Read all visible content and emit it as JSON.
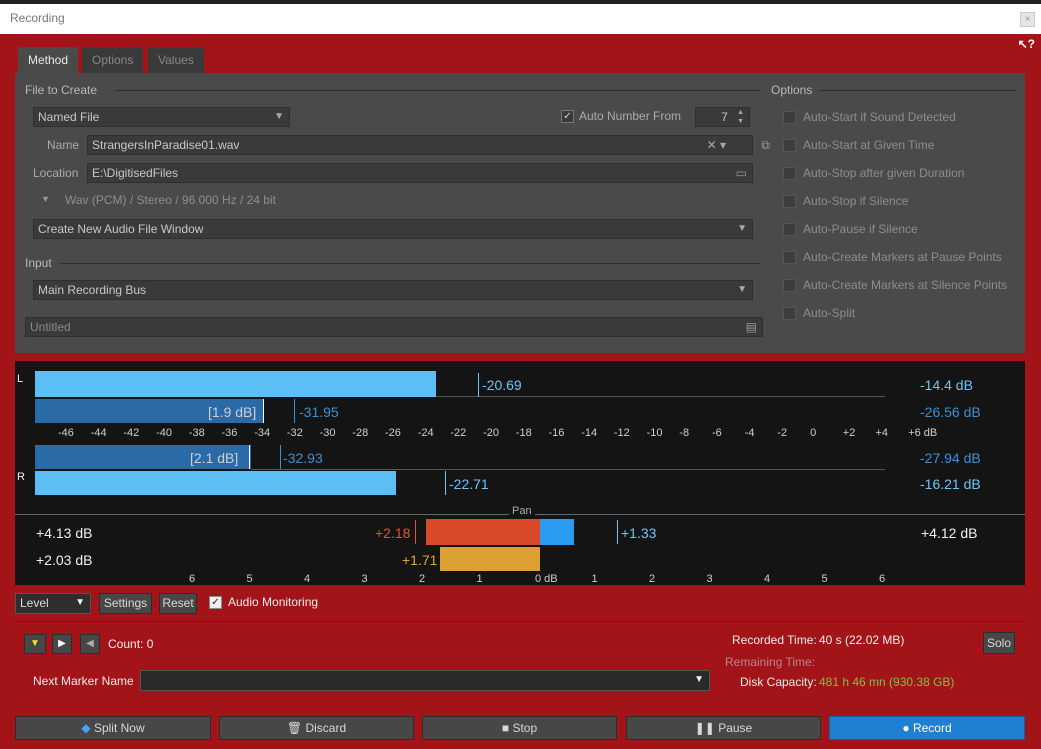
{
  "window": {
    "title": "Recording",
    "close": "×",
    "help": "↖?"
  },
  "tabs": [
    {
      "label": "Method"
    },
    {
      "label": "Options"
    },
    {
      "label": "Values"
    }
  ],
  "file": {
    "section_label": "File to Create",
    "mode": "Named File",
    "auto_number_label": "Auto Number From",
    "auto_number_checked": true,
    "auto_number_value": "7",
    "name_label": "Name",
    "name_value": "StrangersInParadise01.wav",
    "location_label": "Location",
    "location_value": "E:\\DigitisedFiles",
    "format": "Wav (PCM) / Stereo / 96 000 Hz / 24 bit",
    "window_action": "Create New Audio File Window"
  },
  "input": {
    "section_label": "Input",
    "bus": "Main Recording Bus",
    "untitled": "Untitled"
  },
  "options": {
    "section_label": "Options",
    "items": [
      "Auto-Start if Sound Detected",
      "Auto-Start at Given Time",
      "Auto-Stop after given Duration",
      "Auto-Stop if Silence",
      "Auto-Pause if Silence",
      "Auto-Create Markers at Pause Points",
      "Auto-Create Markers at Silence Points",
      "Auto-Split"
    ]
  },
  "meter": {
    "L_label": "L",
    "R_label": "R",
    "L_peak_hold": "-20.69",
    "L_peak_db": "-14.4 dB",
    "L_rms_bracket": "[1.9 dB]",
    "L_rms_hold": "-31.95",
    "L_rms_db": "-26.56 dB",
    "R_rms_bracket": "[2.1 dB]",
    "R_rms_hold": "-32.93",
    "R_rms_db": "-27.94 dB",
    "R_peak_hold": "-22.71",
    "R_peak_db": "-16.21 dB",
    "scale": [
      "-46",
      "-44",
      "-42",
      "-40",
      "-38",
      "-36",
      "-34",
      "-32",
      "-30",
      "-28",
      "-26",
      "-24",
      "-22",
      "-20",
      "-18",
      "-16",
      "-14",
      "-12",
      "-10",
      "-8",
      "-6",
      "-4",
      "-2",
      "0",
      "+2",
      "+4",
      "+6 dB"
    ],
    "pan_label": "Pan",
    "pan_left_top": "+4.13 dB",
    "pan_left_bottom": "+2.03 dB",
    "pan_red_value": "+2.18",
    "pan_orange_value": "+1.71",
    "pan_blue_value": "+1.33",
    "pan_right_top": "+4.12 dB",
    "pan_scale": [
      "6",
      "5",
      "4",
      "3",
      "2",
      "1",
      "0 dB",
      "1",
      "2",
      "3",
      "4",
      "5",
      "6"
    ]
  },
  "controls": {
    "level_select": "Level",
    "settings": "Settings",
    "reset": "Reset",
    "audio_monitoring": "Audio Monitoring",
    "audio_monitoring_checked": true
  },
  "transport": {
    "count": "Count: 0",
    "next_marker_label": "Next Marker Name",
    "recorded_time_label": "Recorded Time:",
    "recorded_time_value": "40 s (22.02 MB)",
    "remaining_time_label": "Remaining Time:",
    "disk_capacity_label": "Disk Capacity:",
    "disk_capacity_value": "481 h 46 mn (930.38 GB)",
    "solo": "Solo"
  },
  "buttons": {
    "split_now": "Split Now",
    "discard": "Discard",
    "stop": "Stop",
    "pause": "Pause",
    "record": "Record"
  }
}
